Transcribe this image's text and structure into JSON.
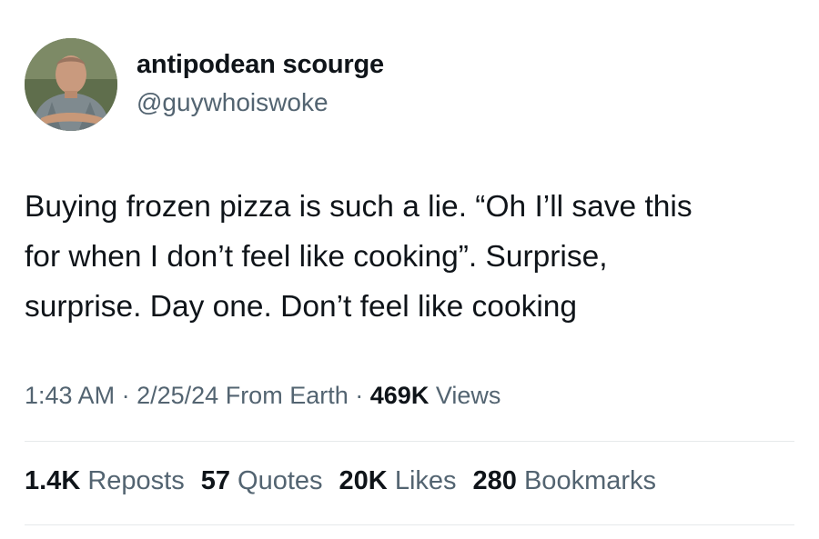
{
  "author": {
    "display_name": "antipodean scourge",
    "handle": "@guywhoiswoke"
  },
  "tweet": {
    "lines": [
      "Buying frozen pizza is such a lie. “Oh I’ll save this",
      "for when I don’t feel like cooking”. Surprise,",
      "surprise. Day one. Don’t feel like cooking"
    ]
  },
  "meta": {
    "time": "1:43 AM",
    "separator": "·",
    "date": "2/25/24",
    "source": "From Earth",
    "views_count": "469K",
    "views_label": "Views"
  },
  "stats": {
    "reposts_count": "1.4K",
    "reposts_label": "Reposts",
    "quotes_count": "57",
    "quotes_label": "Quotes",
    "likes_count": "20K",
    "likes_label": "Likes",
    "bookmarks_count": "280",
    "bookmarks_label": "Bookmarks"
  },
  "colors": {
    "primary_text": "#0f1419",
    "secondary_text": "#536471",
    "divider": "#e6e9eb"
  }
}
